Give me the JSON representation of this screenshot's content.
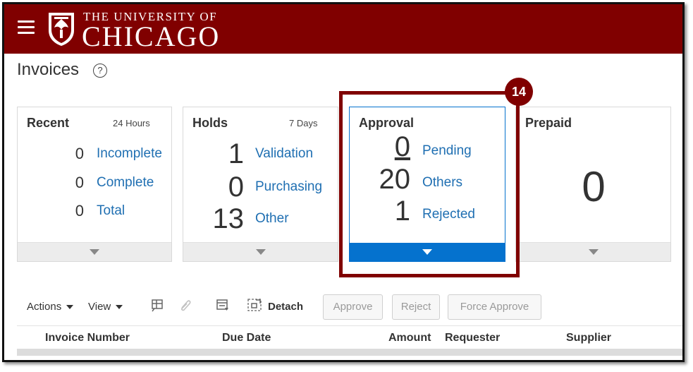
{
  "header": {
    "university_line1": "THE UNIVERSITY OF",
    "university_line2": "CHICAGO",
    "brand_color": "#800000"
  },
  "page": {
    "title": "Invoices",
    "help_glyph": "?"
  },
  "cards": {
    "recent": {
      "title": "Recent",
      "period": "24 Hours",
      "rows": [
        {
          "count": "0",
          "label": "Incomplete"
        },
        {
          "count": "0",
          "label": "Complete"
        },
        {
          "count": "0",
          "label": "Total"
        }
      ]
    },
    "holds": {
      "title": "Holds",
      "period": "7 Days",
      "rows": [
        {
          "count": "1",
          "label": "Validation"
        },
        {
          "count": "0",
          "label": "Purchasing"
        },
        {
          "count": "13",
          "label": "Other"
        }
      ]
    },
    "approval": {
      "title": "Approval",
      "rows": [
        {
          "count": "0",
          "label": "Pending"
        },
        {
          "count": "20",
          "label": "Others"
        },
        {
          "count": "1",
          "label": "Rejected"
        }
      ]
    },
    "prepaid": {
      "title": "Prepaid",
      "count": "0"
    }
  },
  "annotation": {
    "step": "14",
    "color": "#800000"
  },
  "toolbar": {
    "actions": "Actions",
    "view": "View",
    "detach": "Detach",
    "approve": "Approve",
    "reject": "Reject",
    "force_approve": "Force Approve",
    "icons": [
      "freeze-icon",
      "attachment-icon",
      "wrap-icon",
      "detach-icon"
    ]
  },
  "table": {
    "columns": [
      "Invoice Number",
      "Due Date",
      "Amount",
      "Requester",
      "Supplier"
    ]
  },
  "colors": {
    "link": "#1f6fb2",
    "accent": "#0572ce"
  }
}
